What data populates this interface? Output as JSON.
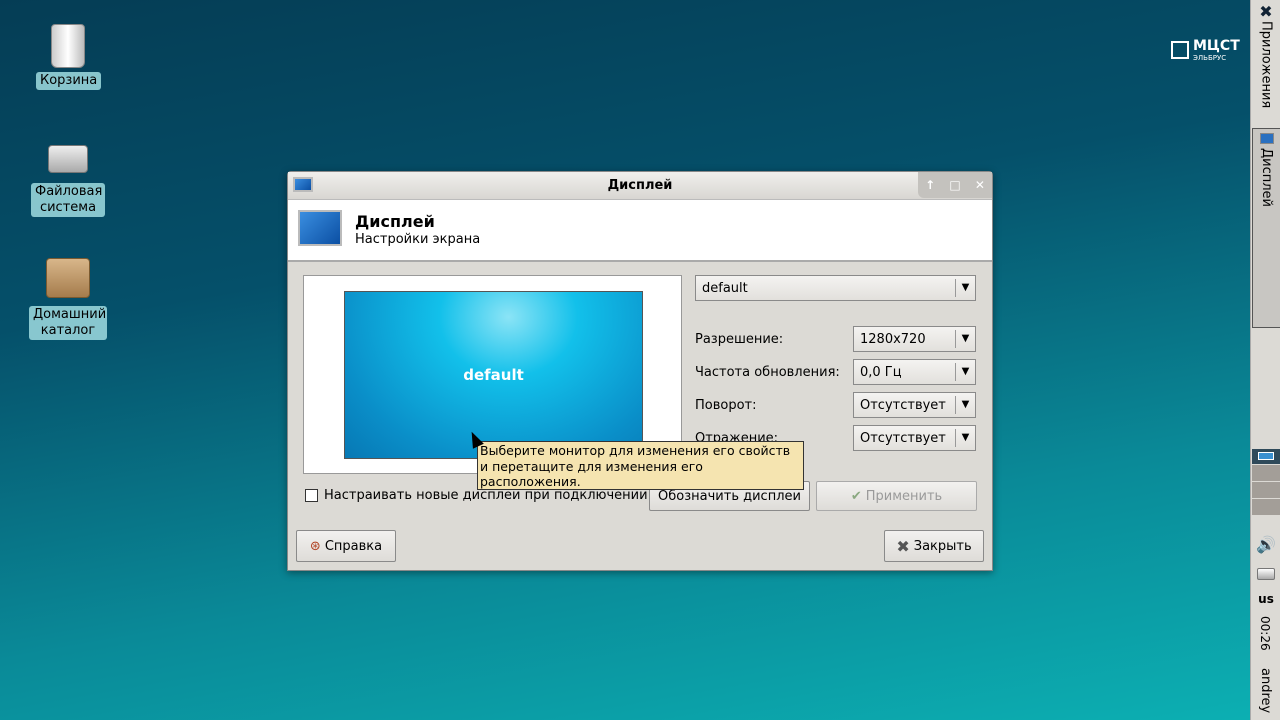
{
  "desktop": {
    "icons": [
      {
        "label": "Корзина"
      },
      {
        "label": "Файловая система"
      },
      {
        "label": "Домашний каталог"
      }
    ],
    "logo": {
      "name": "МЦСТ",
      "sub": "ЭЛЬБРУС"
    }
  },
  "panel": {
    "apps": "Приложения",
    "task": "Дисплей",
    "layout": "us",
    "clock": "00:26",
    "user": "andrey"
  },
  "window": {
    "title": "Дисплей",
    "header_title": "Дисплей",
    "header_subtitle": "Настройки экрана",
    "monitor_label": "default",
    "output_combo": "default",
    "fields": [
      {
        "label": "Разрешение:",
        "value": "1280x720"
      },
      {
        "label": "Частота обновления:",
        "value": "0,0 Гц"
      },
      {
        "label": "Поворот:",
        "value": "Отсутствует"
      },
      {
        "label": "Отражение:",
        "value": "Отсутствует"
      }
    ],
    "checkbox_label": "Настраивать новые дисплеи при подключении",
    "checkbox_checked": false,
    "identify_button": "Обозначить дисплеи",
    "apply_button": "Применить",
    "help_button": "Справка",
    "close_button": "Закрыть",
    "tooltip": "Выберите монитор для изменения его свойств и перетащите для изменения его расположения."
  },
  "colors": {
    "panel": "#dcdad5",
    "tooltip": "#f5e4b0"
  }
}
